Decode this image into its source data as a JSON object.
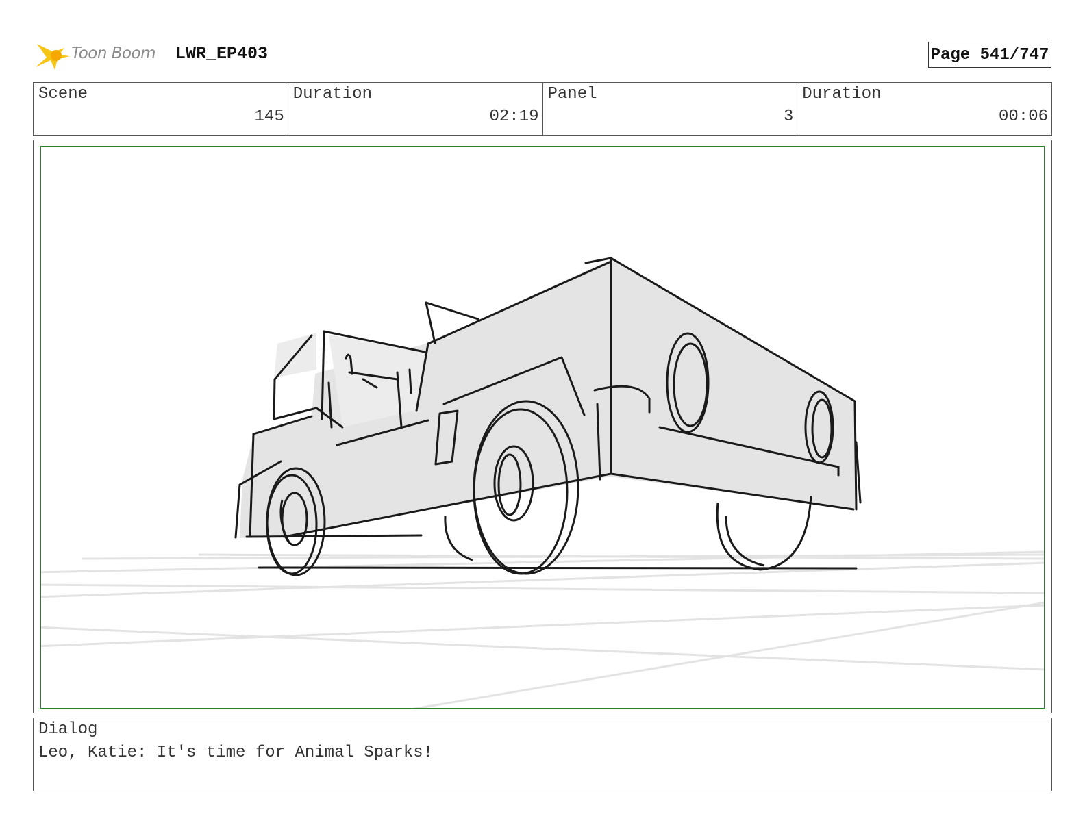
{
  "header": {
    "logo_text": "Toon Boom",
    "project": "LWR_EP403",
    "page": "Page 541/747"
  },
  "info": {
    "scene_label": "Scene",
    "scene_value": "145",
    "scene_duration_label": "Duration",
    "scene_duration_value": "02:19",
    "panel_label": "Panel",
    "panel_value": "3",
    "panel_duration_label": "Duration",
    "panel_duration_value": "00:06"
  },
  "dialog": {
    "label": "Dialog",
    "text": "Leo, Katie: It's time for Animal Sparks!"
  },
  "colors": {
    "panel_border": "#2e7d32",
    "logo_star": "#f5c518"
  }
}
